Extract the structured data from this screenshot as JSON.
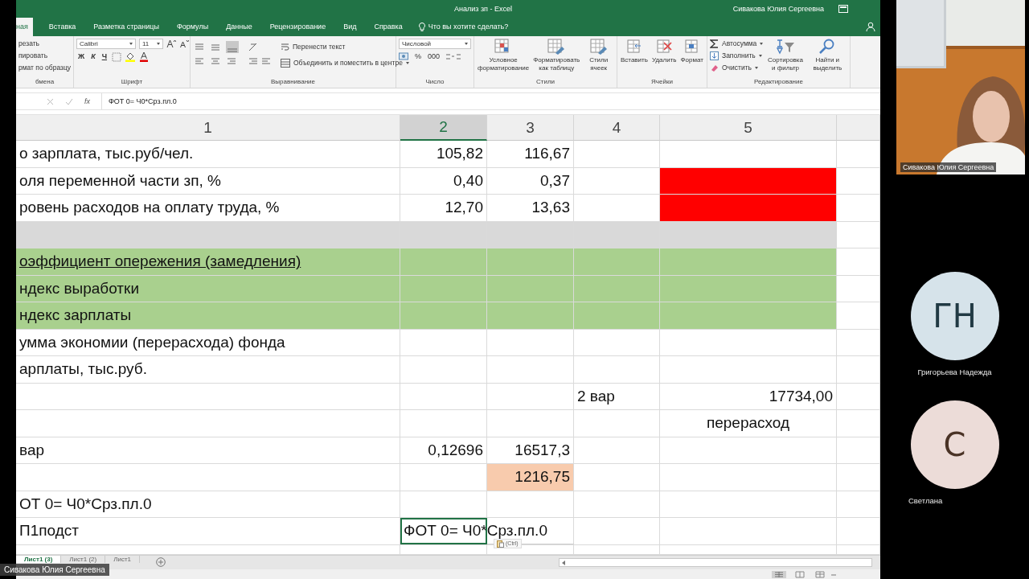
{
  "title_bar": {
    "document_title": "Анализ зп  -  Excel",
    "user": "Сивакова Юлия Сергеевна"
  },
  "ribbon_tabs": [
    {
      "label": "ная",
      "selected": true
    },
    {
      "label": "Вставка",
      "selected": false
    },
    {
      "label": "Разметка страницы",
      "selected": false
    },
    {
      "label": "Формулы",
      "selected": false
    },
    {
      "label": "Данные",
      "selected": false
    },
    {
      "label": "Рецензирование",
      "selected": false
    },
    {
      "label": "Вид",
      "selected": false
    },
    {
      "label": "Справка",
      "selected": false
    }
  ],
  "tell_me": "Что вы хотите сделать?",
  "ribbon_groups": [
    {
      "kind": "clipboard",
      "label": "бмена",
      "items": [
        "резать",
        "пировать",
        "рмат по образцу"
      ]
    },
    {
      "kind": "font",
      "label": "Шрифт",
      "font": "Calibri",
      "size": "11",
      "buttons": [
        "Ж",
        "К",
        "Ч"
      ]
    },
    {
      "kind": "alignment",
      "label": "Выравнивание",
      "items": [
        "Перенести текст",
        "Объединить и поместить в центре"
      ]
    },
    {
      "kind": "number",
      "label": "Число",
      "format": "Числовой",
      "buttons": [
        "%",
        "000"
      ]
    },
    {
      "kind": "styles",
      "label": "Стили",
      "items": [
        "Условное форматирование",
        "Форматировать как таблицу",
        "Стили ячеек"
      ]
    },
    {
      "kind": "cells",
      "label": "Ячейки",
      "items": [
        "Вставить",
        "Удалить",
        "Формат"
      ]
    },
    {
      "kind": "editing",
      "label": "Редактирование",
      "small_items": [
        "Автосумма",
        "Заполнить",
        "Очистить"
      ],
      "items": [
        "Сортировка и фильтр",
        "Найти и выделить"
      ]
    }
  ],
  "formula_bar": {
    "function_glyph": "fx",
    "content": "ФОТ 0= Ч0*Срз.пл.0"
  },
  "columns": [
    {
      "label": "1",
      "selected": false
    },
    {
      "label": "2",
      "selected": true
    },
    {
      "label": "3",
      "selected": false
    },
    {
      "label": "4",
      "selected": false
    },
    {
      "label": "5",
      "selected": false
    }
  ],
  "rows": [
    {
      "cells": [
        {
          "text": "о зарплата, тыс.руб/чел.",
          "kind": "text",
          "selected": false
        },
        {
          "text": "105,82",
          "kind": "number",
          "selected": false
        },
        {
          "text": "116,67",
          "kind": "number",
          "selected": false
        },
        {
          "selected": false
        },
        {
          "selected": false
        }
      ]
    },
    {
      "cells": [
        {
          "text": "оля переменной части зп, %",
          "kind": "text",
          "selected": false
        },
        {
          "text": "0,40",
          "kind": "number",
          "selected": false
        },
        {
          "text": "0,37",
          "kind": "number",
          "selected": false
        },
        {
          "selected": false
        },
        {
          "color": "#ff0000",
          "selected": false
        }
      ]
    },
    {
      "cells": [
        {
          "text": "ровень расходов на оплату труда, %",
          "kind": "text",
          "selected": false
        },
        {
          "text": "12,70",
          "kind": "number",
          "selected": false
        },
        {
          "text": "13,63",
          "kind": "number",
          "selected": false
        },
        {
          "selected": false
        },
        {
          "color": "#ff0000",
          "selected": false
        }
      ]
    },
    {
      "cells": [
        {
          "color": "#d9d9d9",
          "selected": false
        },
        {
          "color": "#d9d9d9",
          "selected": false
        },
        {
          "color": "#d9d9d9",
          "selected": false
        },
        {
          "color": "#d9d9d9",
          "selected": false
        },
        {
          "color": "#d9d9d9",
          "selected": false
        }
      ]
    },
    {
      "cells": [
        {
          "text": "оэффициент опережения (замедления)",
          "kind": "text",
          "underlined": true,
          "color": "#a9d08e",
          "selected": false
        },
        {
          "color": "#a9d08e",
          "selected": false
        },
        {
          "color": "#a9d08e",
          "selected": false
        },
        {
          "color": "#a9d08e",
          "selected": false
        },
        {
          "color": "#a9d08e",
          "selected": false
        }
      ]
    },
    {
      "cells": [
        {
          "text": "ндекс выработки",
          "kind": "text",
          "color": "#a9d08e",
          "selected": false
        },
        {
          "color": "#a9d08e",
          "selected": false
        },
        {
          "color": "#a9d08e",
          "selected": false
        },
        {
          "color": "#a9d08e",
          "selected": false
        },
        {
          "color": "#a9d08e",
          "selected": false
        }
      ]
    },
    {
      "cells": [
        {
          "text": "ндекс зарплаты",
          "kind": "text",
          "color": "#a9d08e",
          "selected": false
        },
        {
          "color": "#a9d08e",
          "selected": false
        },
        {
          "color": "#a9d08e",
          "selected": false
        },
        {
          "color": "#a9d08e",
          "selected": false
        },
        {
          "color": "#a9d08e",
          "selected": false
        }
      ]
    },
    {
      "cells": [
        {
          "text": "умма экономии (перерасхода) фонда",
          "kind": "text",
          "selected": false
        },
        {
          "selected": false
        },
        {
          "selected": false
        },
        {
          "selected": false
        },
        {
          "selected": false
        }
      ]
    },
    {
      "cells": [
        {
          "text": "арплаты, тыс.руб.",
          "kind": "text",
          "selected": false
        },
        {
          "selected": false
        },
        {
          "selected": false
        },
        {
          "selected": false
        },
        {
          "selected": false
        }
      ]
    },
    {
      "cells": [
        {
          "selected": false
        },
        {
          "selected": false
        },
        {
          "selected": false
        },
        {
          "text": "2 вар",
          "kind": "text",
          "selected": false
        },
        {
          "text": "17734,00",
          "kind": "number",
          "selected": false
        }
      ]
    },
    {
      "cells": [
        {
          "selected": false
        },
        {
          "selected": false
        },
        {
          "selected": false
        },
        {
          "selected": false
        },
        {
          "text": "перерасход",
          "kind": "caption",
          "selected": false
        }
      ]
    },
    {
      "cells": [
        {
          "text": "вар",
          "kind": "text",
          "selected": false
        },
        {
          "text": "0,12696",
          "kind": "number",
          "selected": false
        },
        {
          "text": "16517,3",
          "kind": "number",
          "selected": false
        },
        {
          "selected": false
        },
        {
          "selected": false
        }
      ]
    },
    {
      "cells": [
        {
          "selected": false
        },
        {
          "selected": false
        },
        {
          "text": "1216,75",
          "kind": "number",
          "color": "#f8cbad",
          "selected": false
        },
        {
          "selected": false
        },
        {
          "selected": false
        }
      ]
    },
    {
      "cells": [
        {
          "text": "ОТ 0= Ч0*Срз.пл.0",
          "kind": "text",
          "selected": false
        },
        {
          "selected": false
        },
        {
          "selected": false
        },
        {
          "selected": false
        },
        {
          "selected": false
        }
      ]
    },
    {
      "cells": [
        {
          "text": "П1подст",
          "kind": "text",
          "selected": false
        },
        {
          "text": "ФОТ 0= Ч0*Срз.пл.0",
          "kind": "text",
          "selected": true
        },
        {
          "selected": false
        },
        {
          "selected": false
        },
        {
          "selected": false
        }
      ]
    }
  ],
  "paste_options": "(Ctrl)",
  "sheet_tabs": [
    {
      "label": "Лист1 (3)",
      "selected": true
    },
    {
      "label": "Лист1 (2)",
      "selected": false
    },
    {
      "label": "Лист1",
      "selected": false
    }
  ],
  "call": {
    "presenter": {
      "kind": "picture",
      "name": "Сивакова Юлия Сергеевна"
    },
    "participants": [
      {
        "initials": "ГН",
        "name": "Григорьева Надежда",
        "color": "#d6e3ea"
      },
      {
        "initials": "С",
        "name": "Светлана",
        "color": "#ecdcd8"
      }
    ]
  },
  "presenter_tag": "Сивакова Юлия Сергеевна"
}
